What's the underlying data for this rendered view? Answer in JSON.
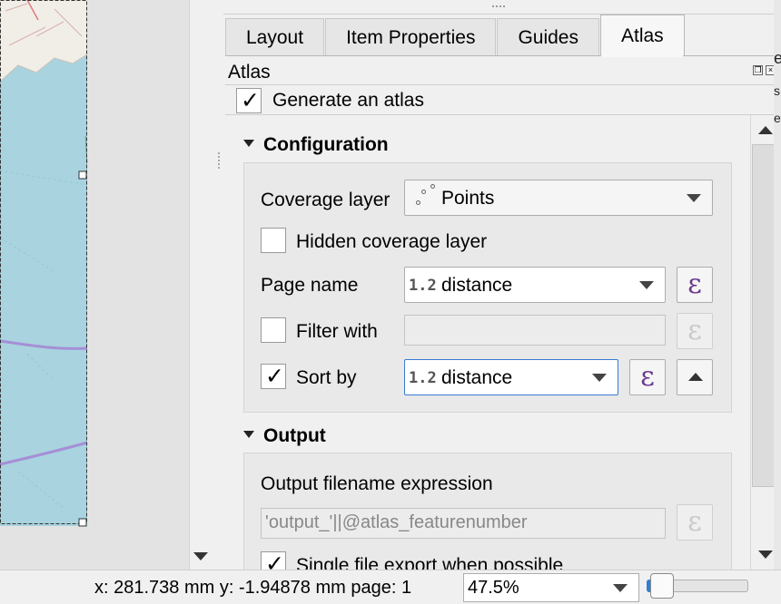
{
  "layout_tabs": [
    {
      "label": "Layout",
      "active": false
    },
    {
      "label": "Item Properties",
      "active": false
    },
    {
      "label": "Guides",
      "active": false
    },
    {
      "label": "Atlas",
      "active": true
    }
  ],
  "panel": {
    "title": "Atlas",
    "generate_label": "Generate an atlas",
    "generate_checked": true
  },
  "configuration": {
    "title": "Configuration",
    "coverage_label": "Coverage layer",
    "coverage_value": "Points",
    "hidden_label": "Hidden coverage layer",
    "hidden_checked": false,
    "page_name_label": "Page name",
    "page_name_type": "1.2",
    "page_name_value": "distance",
    "filter_label": "Filter with",
    "filter_checked": false,
    "filter_value": "",
    "sort_label": "Sort by",
    "sort_checked": true,
    "sort_type": "1.2",
    "sort_value": "distance"
  },
  "output": {
    "title": "Output",
    "filename_label": "Output filename expression",
    "filename_value": "'output_'||@atlas_featurenumber",
    "single_file_label": "Single file export when possible",
    "single_file_checked": true
  },
  "icons": {
    "expression": "ε",
    "check": "✓"
  },
  "statusbar": {
    "coords": "x: 281.738 mm y: -1.94878 mm page: 1",
    "zoom": "47.5%"
  },
  "colors": {
    "map_water": "#a9d3df",
    "map_land": "#f1eee8",
    "route": "#a58fd6",
    "expression_icon": "#6b3a8c",
    "focus_border": "#3a7bd5"
  }
}
